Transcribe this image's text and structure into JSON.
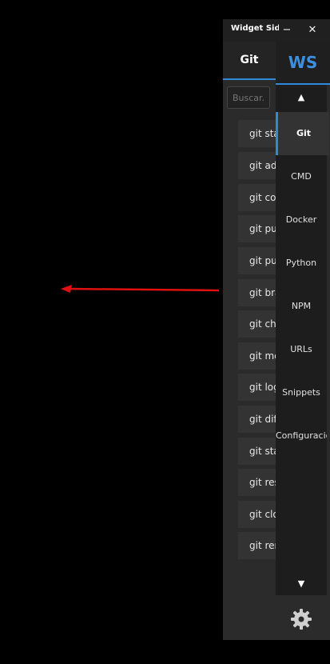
{
  "window": {
    "title": "Widget Sidebar"
  },
  "header": {
    "tab_label": "Git",
    "brand": "WS"
  },
  "search": {
    "placeholder": "Buscar..."
  },
  "commands": [
    "git status",
    "git add",
    "git commit",
    "git push",
    "git pull",
    "git branch",
    "git checkout",
    "git merge",
    "git log",
    "git diff",
    "git stash",
    "git reset",
    "git clone",
    "git remote"
  ],
  "nav": {
    "up_arrow": "▲",
    "down_arrow": "▼",
    "items": [
      "Git",
      "CMD",
      "Docker",
      "Python",
      "NPM",
      "URLs",
      "Snippets",
      "Configuración"
    ]
  },
  "colors": {
    "accent": "#2f88d8",
    "arrow": "#e01010"
  },
  "icons": {
    "settings": "gear-icon",
    "arrow": "left-arrow-icon"
  }
}
